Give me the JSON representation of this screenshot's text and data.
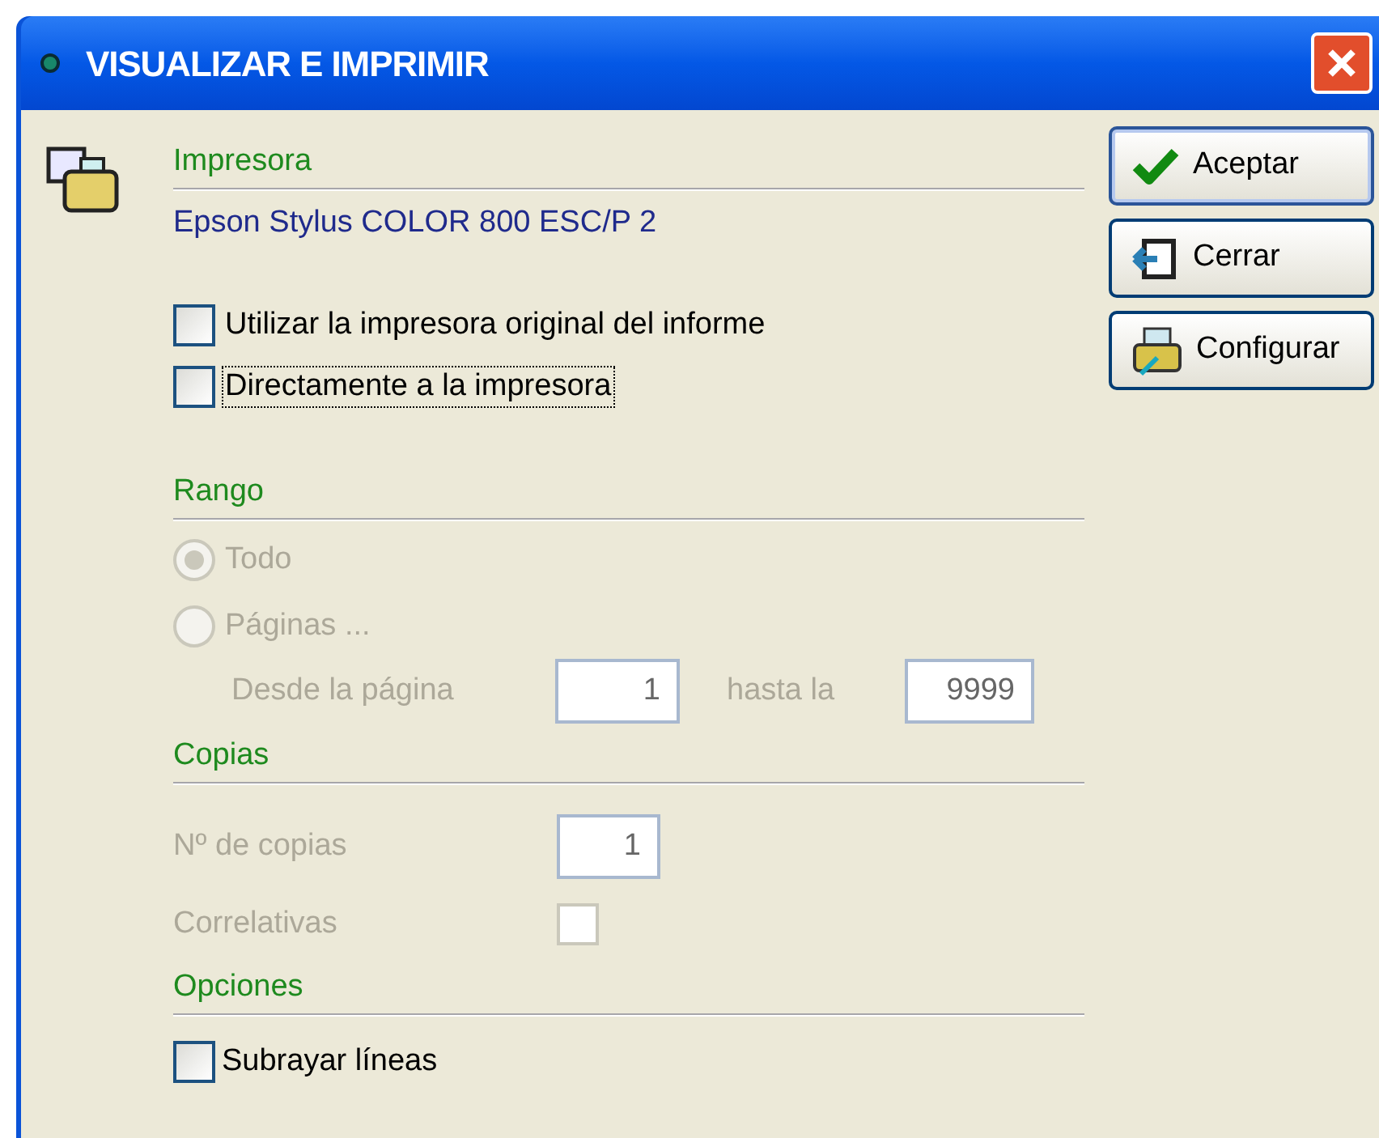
{
  "window": {
    "title": "VISUALIZAR E IMPRIMIR"
  },
  "printer": {
    "heading": "Impresora",
    "name": "Epson Stylus COLOR 800 ESC/P 2",
    "options": [
      {
        "label": "Utilizar la impresora original del informe",
        "checked": false,
        "focused": false
      },
      {
        "label": "Directamente a la impresora",
        "checked": false,
        "focused": true
      }
    ]
  },
  "range": {
    "heading": "Rango",
    "disabled": true,
    "choices": [
      {
        "label": "Todo",
        "selected": true
      },
      {
        "label": "Páginas ...",
        "selected": false
      }
    ],
    "from_label": "Desde la página",
    "from_value": "1",
    "to_label": "hasta la",
    "to_value": "9999"
  },
  "copies": {
    "heading": "Copias",
    "disabled": true,
    "count_label": "Nº de copias",
    "count_value": "1",
    "collate_label": "Correlativas",
    "collate_checked": false
  },
  "options": {
    "heading": "Opciones",
    "items": [
      {
        "label": "Subrayar líneas",
        "checked": false
      }
    ]
  },
  "buttons": [
    {
      "label": "Aceptar",
      "kind": "ok",
      "default": true
    },
    {
      "label": "Cerrar",
      "kind": "close",
      "default": false
    },
    {
      "label": "Configurar",
      "kind": "setup",
      "default": false
    }
  ]
}
